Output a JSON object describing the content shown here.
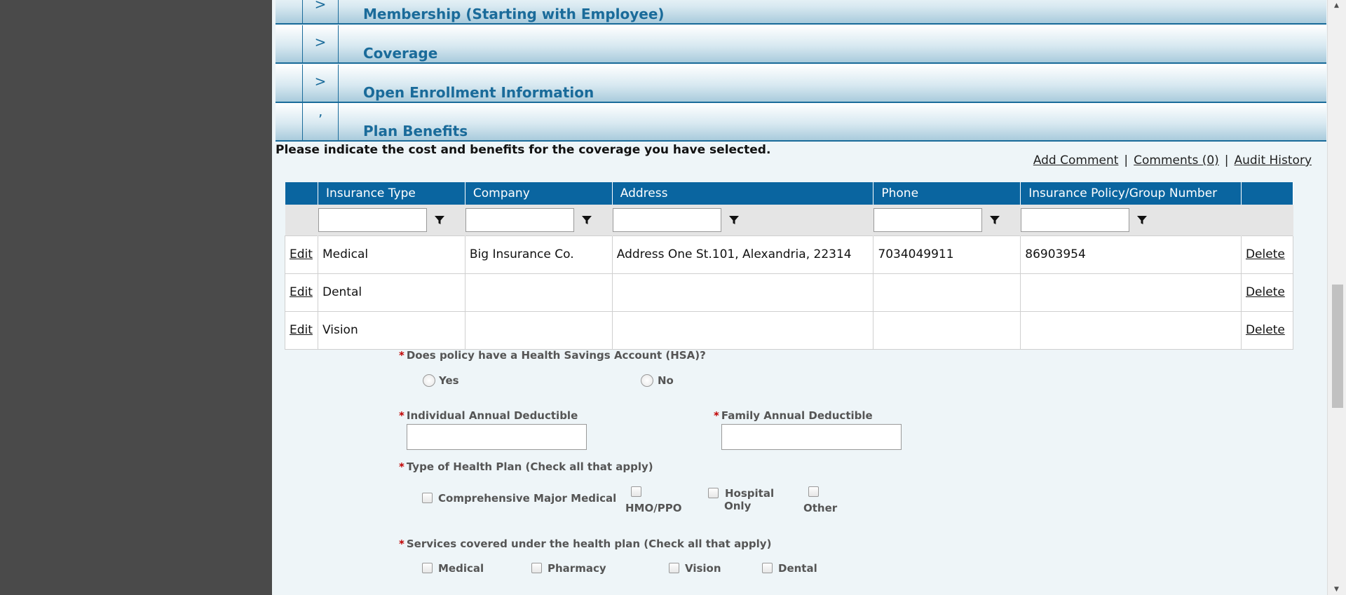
{
  "sections": [
    {
      "chevron": ">",
      "title": "Membership (Starting with Employee)"
    },
    {
      "chevron": ">",
      "title": "Coverage"
    },
    {
      "chevron": ">",
      "title": "Open Enrollment Information"
    },
    {
      "chevron": "’",
      "title": "Plan Benefits"
    }
  ],
  "instruction": "Please indicate the cost and benefits for the coverage you have selected.",
  "links": {
    "add_comment": "Add Comment",
    "comments": "Comments (0)",
    "audit_history": "Audit History",
    "separator": "|"
  },
  "table": {
    "headers": [
      "Insurance Type",
      "Company",
      "Address",
      "Phone",
      "Insurance Policy/Group Number"
    ],
    "edit_label": "Edit",
    "delete_label": "Delete",
    "rows": [
      {
        "type": "Medical",
        "company": "Big Insurance Co.",
        "address": "Address One St.101, Alexandria, 22314",
        "phone": "7034049911",
        "policy": "86903954"
      },
      {
        "type": "Dental",
        "company": "",
        "address": "",
        "phone": "",
        "policy": ""
      },
      {
        "type": "Vision",
        "company": "",
        "address": "",
        "phone": "",
        "policy": ""
      }
    ]
  },
  "form": {
    "required_mark": "*",
    "hsa_question": "Does policy have a Health Savings Account (HSA)?",
    "hsa_yes": "Yes",
    "hsa_no": "No",
    "individual_deductible": "Individual Annual Deductible",
    "family_deductible": "Family Annual Deductible",
    "plan_type_question": "Type of Health Plan (Check all that apply)",
    "plan_types": {
      "comprehensive": "Comprehensive Major Medical",
      "hmo": "HMO/PPO",
      "hospital_line1": "Hospital",
      "hospital_line2": "Only",
      "other": "Other"
    },
    "services_question": "Services covered under the health plan (Check all that apply)",
    "services": {
      "medical": "Medical",
      "pharmacy": "Pharmacy",
      "vision": "Vision",
      "dental": "Dental"
    }
  },
  "colors": {
    "header_blue": "#0a65a0",
    "section_text": "#1a6b9a",
    "required": "#c00000",
    "page_bg": "#eef5f8"
  },
  "icons": {
    "filter": "funnel-icon",
    "scroll_up": "triangle-up",
    "scroll_down": "triangle-down"
  }
}
